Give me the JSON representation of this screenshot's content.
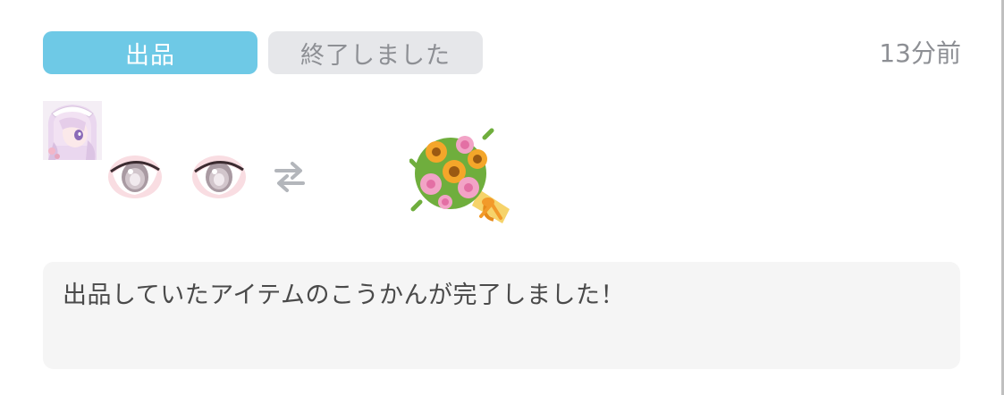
{
  "header": {
    "badges": [
      {
        "label": "出品",
        "color": "#6ec9e6"
      },
      {
        "label": "終了しました",
        "color": "#e6e7ea"
      }
    ],
    "timestamp": "13分前"
  },
  "trade": {
    "user_avatar": "pink-haired-girl-avatar",
    "given_items": [
      "eye-item-icon",
      "eye-item-icon"
    ],
    "swap_icon": "swap-arrows-icon",
    "received_item": "flower-bouquet-icon"
  },
  "message": {
    "text": "出品していたアイテムのこうかんが完了しました！"
  }
}
